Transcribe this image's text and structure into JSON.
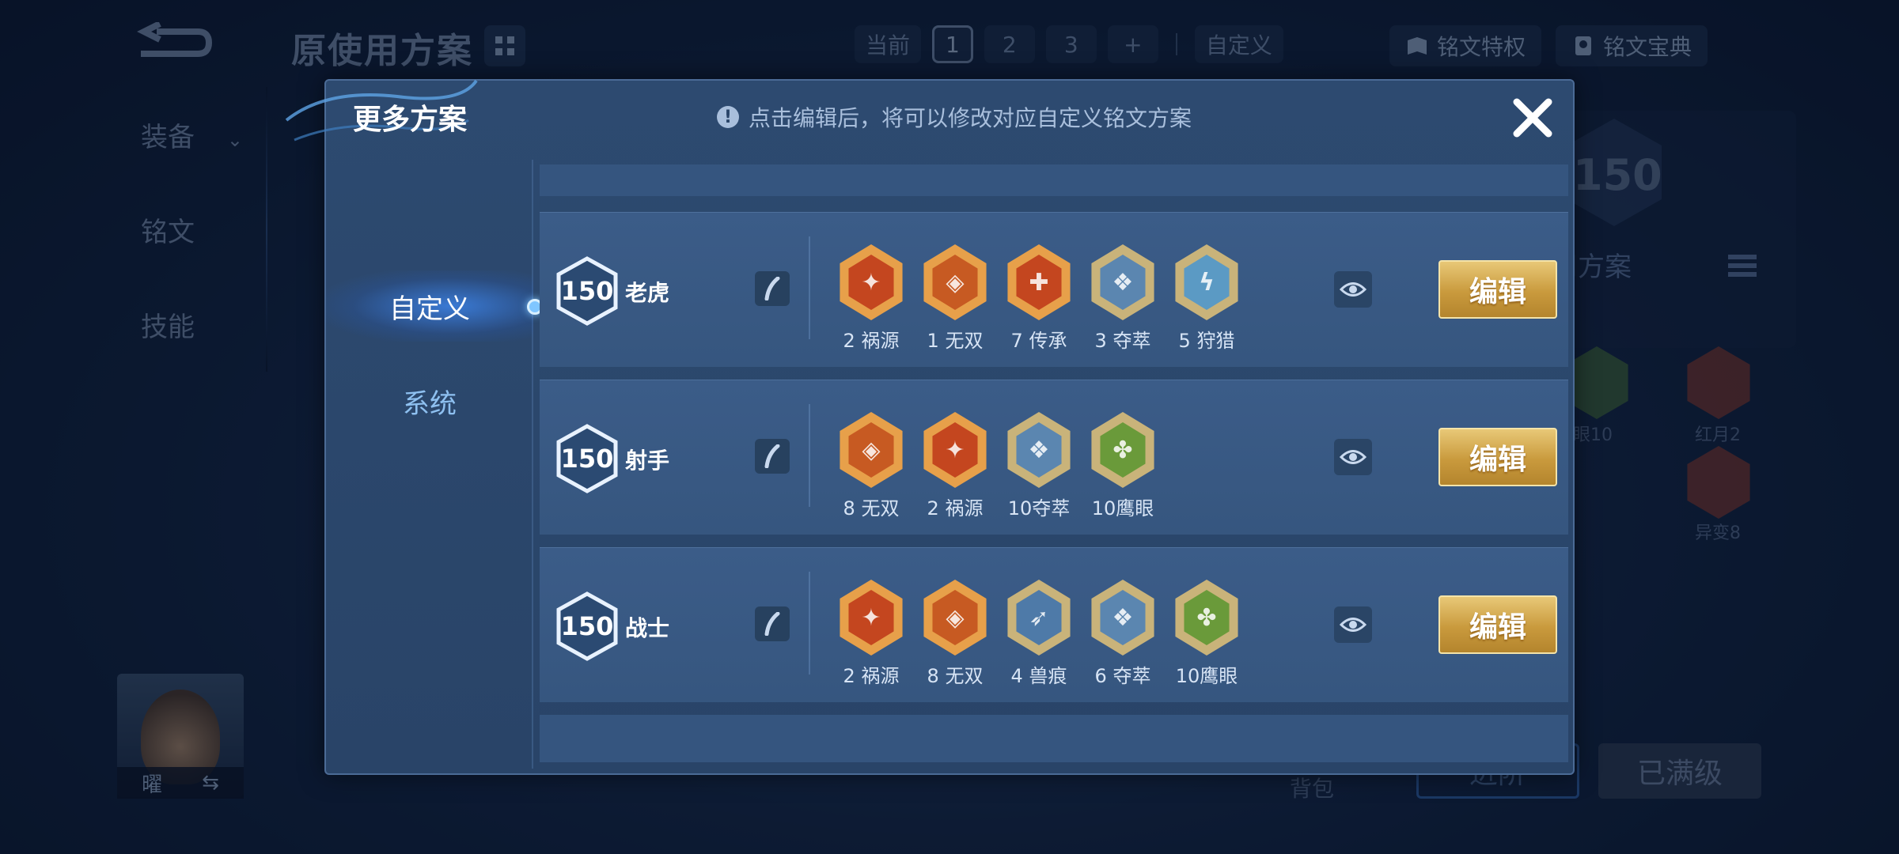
{
  "background": {
    "page_title": "原使用方案",
    "top_tabs": {
      "current_label": "当前",
      "plan_numbers": [
        "1",
        "2",
        "3"
      ],
      "add_label": "+",
      "custom_label": "自定义"
    },
    "privilege_btn": "铭文特权",
    "codex_btn": "铭文宝典",
    "side_nav": [
      "装备",
      "铭文",
      "技能"
    ],
    "hero_name": "曜",
    "swap_icon": "⇆",
    "bag_label": "背包",
    "left_bottom_btn": "进阶",
    "maxed_btn": "已满级",
    "right_level": "150",
    "right_plan_label": "用方案",
    "bg_runes": [
      {
        "label": "眼10",
        "color": "#5a8a3a"
      },
      {
        "label": "红月2",
        "color": "#b2442a"
      },
      {
        "label": "异变8",
        "color": "#b2442a"
      }
    ]
  },
  "modal": {
    "title": "更多方案",
    "hint_icon": "!",
    "hint": "点击编辑后，将可以修改对应自定义铭文方案",
    "close_icon": "close-icon",
    "tabs": [
      {
        "label": "自定义",
        "active": true
      },
      {
        "label": "系统",
        "active": false
      }
    ],
    "rows": [
      {
        "level": "150",
        "name": "老虎",
        "runes": [
          {
            "label": "2 祸源",
            "color": "#c4461f",
            "glyph": "✦"
          },
          {
            "label": "1 无双",
            "color": "#c75a22",
            "glyph": "◈"
          },
          {
            "label": "7 传承",
            "color": "#c4461f",
            "glyph": "✚"
          },
          {
            "label": "3 夺萃",
            "color": "#5b86b0",
            "glyph": "❖"
          },
          {
            "label": "5 狩猎",
            "color": "#5b9ac4",
            "glyph": "ϟ"
          }
        ],
        "edit_label": "编辑"
      },
      {
        "level": "150",
        "name": "射手",
        "runes": [
          {
            "label": "8 无双",
            "color": "#c75a22",
            "glyph": "◈"
          },
          {
            "label": "2 祸源",
            "color": "#c4461f",
            "glyph": "✦"
          },
          {
            "label": "10夺萃",
            "color": "#5b86b0",
            "glyph": "❖"
          },
          {
            "label": "10鹰眼",
            "color": "#6a9a3a",
            "glyph": "✤"
          }
        ],
        "edit_label": "编辑"
      },
      {
        "level": "150",
        "name": "战士",
        "runes": [
          {
            "label": "2 祸源",
            "color": "#c4461f",
            "glyph": "✦"
          },
          {
            "label": "8 无双",
            "color": "#c75a22",
            "glyph": "◈"
          },
          {
            "label": "4 兽痕",
            "color": "#4e7aa8",
            "glyph": "➶"
          },
          {
            "label": "6 夺萃",
            "color": "#5b86b0",
            "glyph": "❖"
          },
          {
            "label": "10鹰眼",
            "color": "#6a9a3a",
            "glyph": "✤"
          }
        ],
        "edit_label": "编辑"
      }
    ]
  }
}
